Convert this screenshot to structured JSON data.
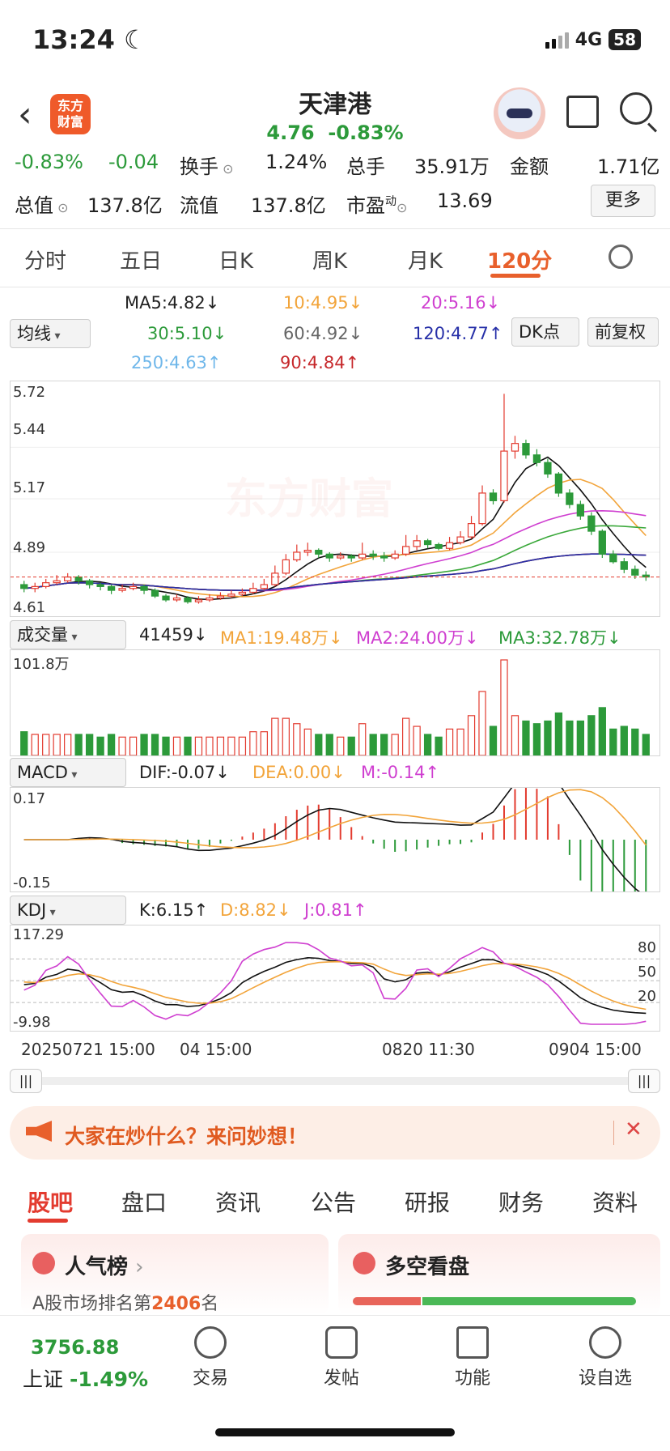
{
  "status": {
    "time": "13:24",
    "network": "4G",
    "battery": "58"
  },
  "header": {
    "stock_name": "天津港",
    "price": "4.76",
    "change_pct": "-0.83%",
    "logo_text": "东方财富"
  },
  "quote": {
    "change_pct": "-0.83%",
    "change": "-0.04",
    "turnover_label": "换手",
    "turnover": "1.24%",
    "volume_label": "总手",
    "volume": "35.91万",
    "amount_label": "金额",
    "amount": "1.71亿",
    "mktcap_label": "总值",
    "mktcap": "137.8亿",
    "float_label": "流值",
    "float": "137.8亿",
    "pe_label": "市盈",
    "pe_sup": "动",
    "pe": "13.69",
    "more_label": "更多"
  },
  "period_tabs": [
    "分时",
    "五日",
    "日K",
    "周K",
    "月K",
    "120分"
  ],
  "ma": {
    "selector": "均线",
    "ma5": "MA5:4.82",
    "ma10": "10:4.95",
    "ma20": "20:5.16",
    "ma30": "30:5.10",
    "ma60": "60:4.92",
    "ma120": "120:4.77",
    "ma250": "250:4.63",
    "ma90": "90:4.84",
    "dk_label": "DK点",
    "adjust_label": "前复权"
  },
  "indicators": {
    "volume": {
      "selector": "成交量",
      "value": "41459",
      "ma1": "MA1:19.48万",
      "ma2": "MA2:24.00万",
      "ma3": "MA3:32.78万",
      "top": "101.8万"
    },
    "macd": {
      "selector": "MACD",
      "dif": "DIF:-0.07",
      "dea": "DEA:0.00",
      "m": "M:-0.14",
      "top": "0.17",
      "bottom": "-0.15"
    },
    "kdj": {
      "selector": "KDJ",
      "k": "K:6.15",
      "d": "D:8.82",
      "j": "J:0.81",
      "top": "117.29",
      "bottom": "-9.98",
      "levels": [
        "80",
        "50",
        "20"
      ]
    }
  },
  "chart_data": {
    "type": "candlestick",
    "y_ticks": [
      "5.72",
      "5.44",
      "5.17",
      "4.89",
      "4.61"
    ],
    "watermark": "东方财富",
    "x_ticks": [
      "20250721 15:00",
      "04 15:00",
      "0820 11:30",
      "0904 15:00"
    ],
    "candles": [
      [
        4.72,
        4.7,
        4.74,
        4.68
      ],
      [
        4.7,
        4.71,
        4.73,
        4.68
      ],
      [
        4.71,
        4.73,
        4.75,
        4.7
      ],
      [
        4.73,
        4.74,
        4.77,
        4.72
      ],
      [
        4.74,
        4.76,
        4.78,
        4.73
      ],
      [
        4.76,
        4.74,
        4.77,
        4.72
      ],
      [
        4.74,
        4.72,
        4.75,
        4.7
      ],
      [
        4.72,
        4.71,
        4.73,
        4.69
      ],
      [
        4.71,
        4.69,
        4.72,
        4.67
      ],
      [
        4.69,
        4.7,
        4.72,
        4.68
      ],
      [
        4.7,
        4.71,
        4.73,
        4.69
      ],
      [
        4.71,
        4.69,
        4.72,
        4.67
      ],
      [
        4.69,
        4.66,
        4.7,
        4.65
      ],
      [
        4.66,
        4.64,
        4.67,
        4.63
      ],
      [
        4.64,
        4.65,
        4.67,
        4.63
      ],
      [
        4.65,
        4.63,
        4.66,
        4.62
      ],
      [
        4.63,
        4.64,
        4.66,
        4.62
      ],
      [
        4.64,
        4.65,
        4.67,
        4.63
      ],
      [
        4.65,
        4.66,
        4.68,
        4.64
      ],
      [
        4.66,
        4.67,
        4.69,
        4.65
      ],
      [
        4.67,
        4.68,
        4.7,
        4.66
      ],
      [
        4.68,
        4.7,
        4.73,
        4.67
      ],
      [
        4.7,
        4.72,
        4.75,
        4.69
      ],
      [
        4.72,
        4.78,
        4.82,
        4.71
      ],
      [
        4.78,
        4.85,
        4.88,
        4.77
      ],
      [
        4.85,
        4.89,
        4.93,
        4.84
      ],
      [
        4.89,
        4.9,
        4.94,
        4.87
      ],
      [
        4.9,
        4.88,
        4.91,
        4.86
      ],
      [
        4.88,
        4.86,
        4.89,
        4.84
      ],
      [
        4.86,
        4.87,
        4.89,
        4.85
      ],
      [
        4.87,
        4.86,
        4.88,
        4.84
      ],
      [
        4.86,
        4.88,
        4.94,
        4.85
      ],
      [
        4.88,
        4.87,
        4.9,
        4.85
      ],
      [
        4.87,
        4.86,
        4.89,
        4.84
      ],
      [
        4.86,
        4.88,
        4.9,
        4.85
      ],
      [
        4.88,
        4.92,
        4.98,
        4.87
      ],
      [
        4.92,
        4.95,
        4.98,
        4.9
      ],
      [
        4.95,
        4.93,
        4.96,
        4.91
      ],
      [
        4.93,
        4.91,
        4.94,
        4.9
      ],
      [
        4.91,
        4.94,
        4.97,
        4.9
      ],
      [
        4.94,
        4.97,
        5.0,
        4.93
      ],
      [
        4.97,
        5.04,
        5.08,
        4.96
      ],
      [
        5.04,
        5.2,
        5.24,
        5.03
      ],
      [
        5.2,
        5.16,
        5.22,
        5.14
      ],
      [
        5.16,
        5.42,
        5.72,
        5.15
      ],
      [
        5.42,
        5.46,
        5.5,
        5.38
      ],
      [
        5.46,
        5.4,
        5.48,
        5.38
      ],
      [
        5.4,
        5.36,
        5.43,
        5.34
      ],
      [
        5.36,
        5.3,
        5.38,
        5.28
      ],
      [
        5.3,
        5.2,
        5.31,
        5.18
      ],
      [
        5.2,
        5.14,
        5.22,
        5.12
      ],
      [
        5.14,
        5.08,
        5.16,
        5.06
      ],
      [
        5.08,
        5.0,
        5.1,
        4.98
      ],
      [
        5.0,
        4.88,
        5.01,
        4.86
      ],
      [
        4.88,
        4.84,
        4.9,
        4.83
      ],
      [
        4.84,
        4.8,
        4.86,
        4.78
      ],
      [
        4.8,
        4.77,
        4.82,
        4.75
      ],
      [
        4.77,
        4.76,
        4.79,
        4.74
      ]
    ]
  },
  "promo": {
    "text": "大家在炒什么？来问妙想！",
    "close": "✕"
  },
  "section_tabs": [
    "股吧",
    "盘口",
    "资讯",
    "公告",
    "研报",
    "财务",
    "资料"
  ],
  "cards": {
    "popularity": {
      "title": "人气榜",
      "rank_prefix": "A股市场排名第",
      "rank": "2406",
      "rank_suffix": "名"
    },
    "longshort": {
      "title": "多空看盘"
    }
  },
  "bottom": {
    "index_value": "3756.88",
    "index_name": "上证",
    "index_change": "-1.49%",
    "nav": [
      "交易",
      "发帖",
      "功能",
      "设自选"
    ]
  }
}
